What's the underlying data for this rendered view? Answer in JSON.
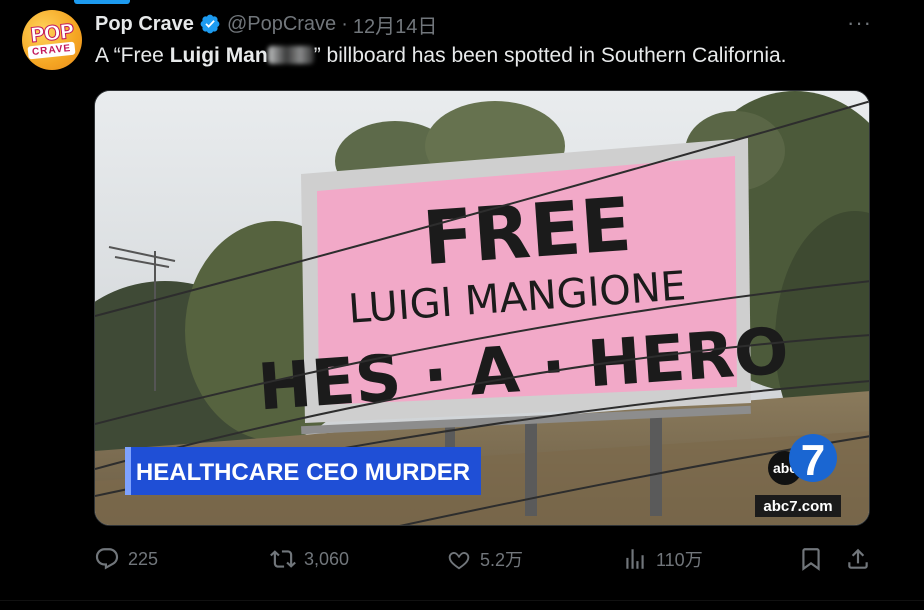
{
  "account": {
    "avatar_text_top": "POP",
    "avatar_text_bottom": "CRAVE",
    "name": "Pop Crave",
    "handle": "@PopCrave",
    "separator": "·",
    "date": "12月14日"
  },
  "more_label": "···",
  "tweet": {
    "text_prefix": "A “Free ",
    "text_bold": "Luigi Man",
    "text_suffix": "” billboard has been spotted in Southern California."
  },
  "media": {
    "billboard_line1": "FREE",
    "billboard_line2": "LUIGI MANGIONE",
    "billboard_line3": "HES · A · HERO",
    "news_banner": "HEALTHCARE CEO MURDER",
    "network_logo_text": "abc",
    "network_logo_number": "7",
    "network_url": "abc7.com"
  },
  "actions": {
    "replies": "225",
    "reposts": "3,060",
    "likes": "5.2万",
    "views": "110万"
  },
  "colors": {
    "accent": "#1d9bf0",
    "muted": "#71767b",
    "banner_blue": "#1f4fd6",
    "billboard_pink": "#f2a9c8"
  }
}
